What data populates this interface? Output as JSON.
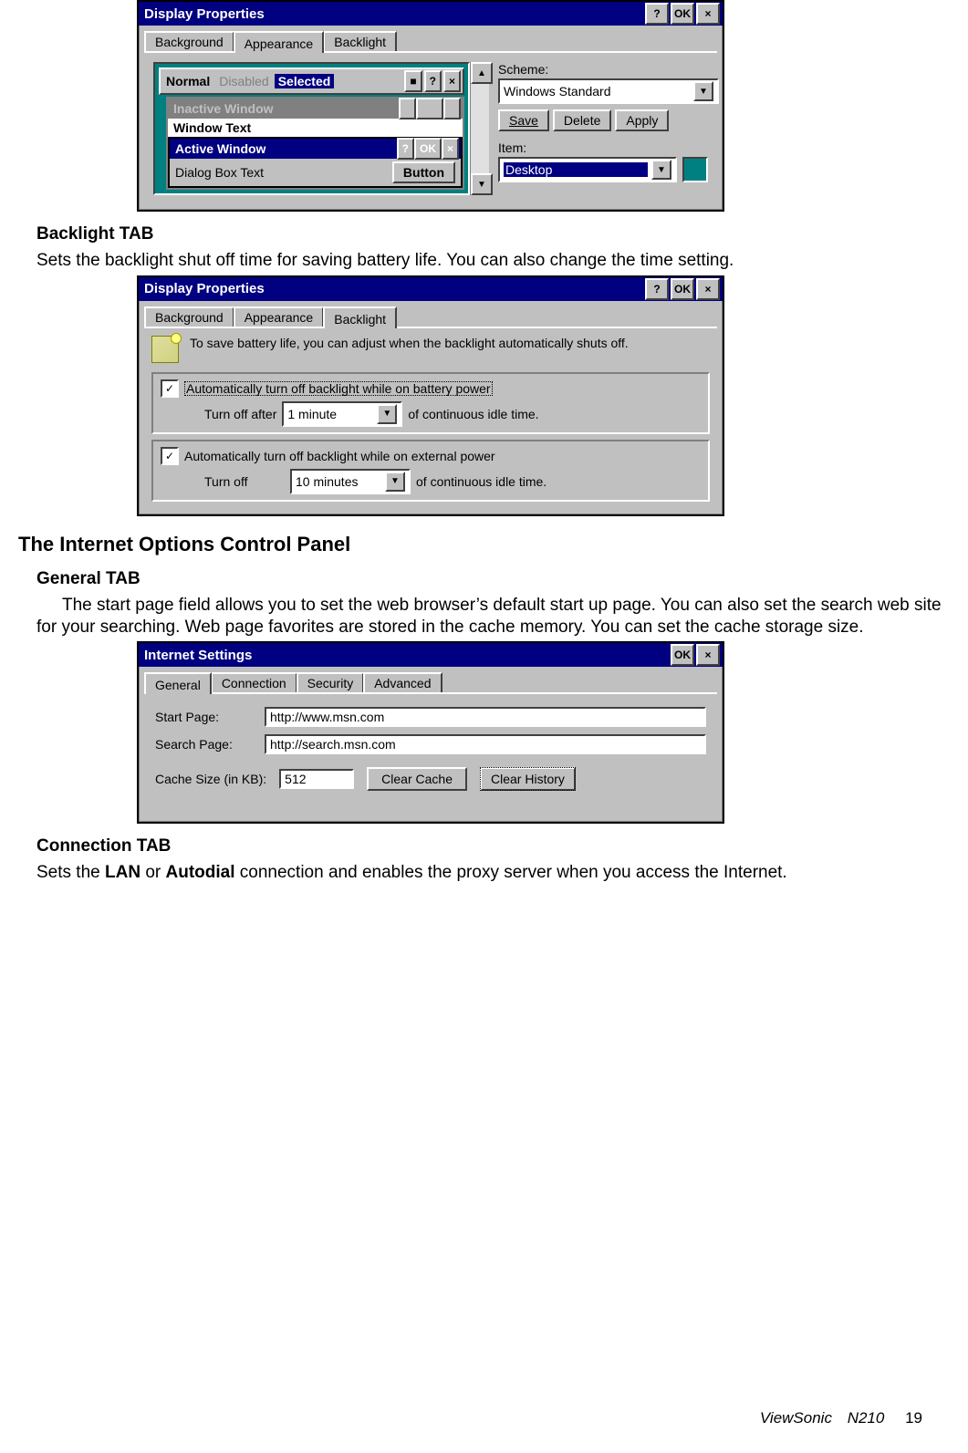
{
  "doc": {
    "backlight_heading": "Backlight TAB",
    "backlight_para": "Sets the backlight shut off time for saving battery life. You can also change the time setting.",
    "internet_heading": "The Internet Options Control Panel",
    "general_heading": "General TAB",
    "general_para": "The start page field allows you to set the web browser’s default start up page. You can also set the search web site for your searching. Web page favorites are stored in the cache memory. You can set the cache storage size.",
    "conn_heading": "Connection TAB",
    "conn_para_1": "Sets the ",
    "conn_bold_1": "LAN",
    "conn_mid": " or ",
    "conn_bold_2": "Autodial",
    "conn_para_2": " connection and enables the proxy server when you access the Internet.",
    "footer_brand": "ViewSonic",
    "footer_model": "N210",
    "footer_page": "19"
  },
  "dlg1": {
    "title": "Display Properties",
    "btn_help": "?",
    "btn_ok": "OK",
    "btn_close": "×",
    "tabs": {
      "background": "Background",
      "appearance": "Appearance",
      "backlight": "Backlight"
    },
    "preview": {
      "menu_normal": "Normal",
      "menu_disabled": "Disabled",
      "menu_selected": "Selected",
      "sq": "■",
      "help": "?",
      "close": "×",
      "inactive": "Inactive Window",
      "ok": "OK",
      "window_text": "Window Text",
      "active": "Active Window",
      "dialog_text": "Dialog Box Text",
      "button": "Button"
    },
    "scheme_label": "Scheme:",
    "scheme_value": "Windows Standard",
    "save": "Save",
    "delete": "Delete",
    "apply": "Apply",
    "item_label": "Item:",
    "item_value": "Desktop",
    "color": "#008080"
  },
  "dlg2": {
    "title": "Display Properties",
    "btn_help": "?",
    "btn_ok": "OK",
    "btn_close": "×",
    "tabs": {
      "background": "Background",
      "appearance": "Appearance",
      "backlight": "Backlight"
    },
    "desc": "To save battery life, you can adjust when the backlight automatically shuts off.",
    "chk1": "Automatically turn off backlight while on battery power",
    "chk1_pre": "Turn off after",
    "chk1_val": "1 minute",
    "chk1_post": "of continuous idle time.",
    "chk2": "Automatically turn off backlight while on external power",
    "chk2_pre": "Turn off",
    "chk2_val": "10 minutes",
    "chk2_post": "of continuous idle time."
  },
  "dlg3": {
    "title": "Internet Settings",
    "btn_ok": "OK",
    "btn_close": "×",
    "tabs": {
      "general": "General",
      "connection": "Connection",
      "security": "Security",
      "advanced": "Advanced"
    },
    "start_label": "Start Page:",
    "start_val": "http://www.msn.com",
    "search_label": "Search Page:",
    "search_val": "http://search.msn.com",
    "cache_label": "Cache Size (in KB):",
    "cache_val": "512",
    "clear_cache": "Clear Cache",
    "clear_history": "Clear History"
  }
}
